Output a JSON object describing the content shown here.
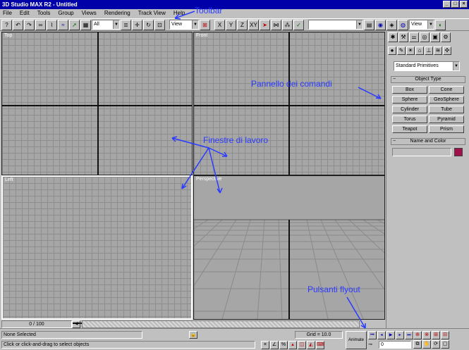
{
  "window": {
    "title": "3D Studio MAX R2 - Untitled",
    "minimize": "_",
    "maximize": "□",
    "close": "×"
  },
  "menu": [
    "File",
    "Edit",
    "Tools",
    "Group",
    "Views",
    "Rendering",
    "Track View",
    "Help"
  ],
  "toolbar": {
    "select_filter": "All",
    "coord_dropdown": "View",
    "view_dropdown": "View",
    "axis_x": "X",
    "axis_y": "Y",
    "axis_z": "Z",
    "axis_xy": "XY",
    "named_selection": ""
  },
  "viewports": {
    "top": "Top",
    "front": "Front",
    "left": "Left",
    "perspective": "Perspective"
  },
  "command_panel": {
    "dropdown": "Standard Primitives",
    "object_type_header": "Object Type",
    "buttons": [
      "Box",
      "Cone",
      "Sphere",
      "GeoSphere",
      "Cylinder",
      "Tube",
      "Torus",
      "Pyramid",
      "Teapot",
      "Prism"
    ],
    "name_color_header": "Name and Color",
    "object_color": "#a0104a"
  },
  "status": {
    "time_slider": "0 / 100",
    "selection": "None Selected",
    "prompt": "Click or click-and-drag to select objects",
    "grid": "Grid = 10.0",
    "animate": "Animate",
    "frame": "0"
  },
  "annotations": {
    "toolbar": "Toolbar",
    "command_panel": "Pannello dei comandi",
    "viewports": "Finestre di lavoro",
    "flyout": "Pulsanti flyout"
  }
}
